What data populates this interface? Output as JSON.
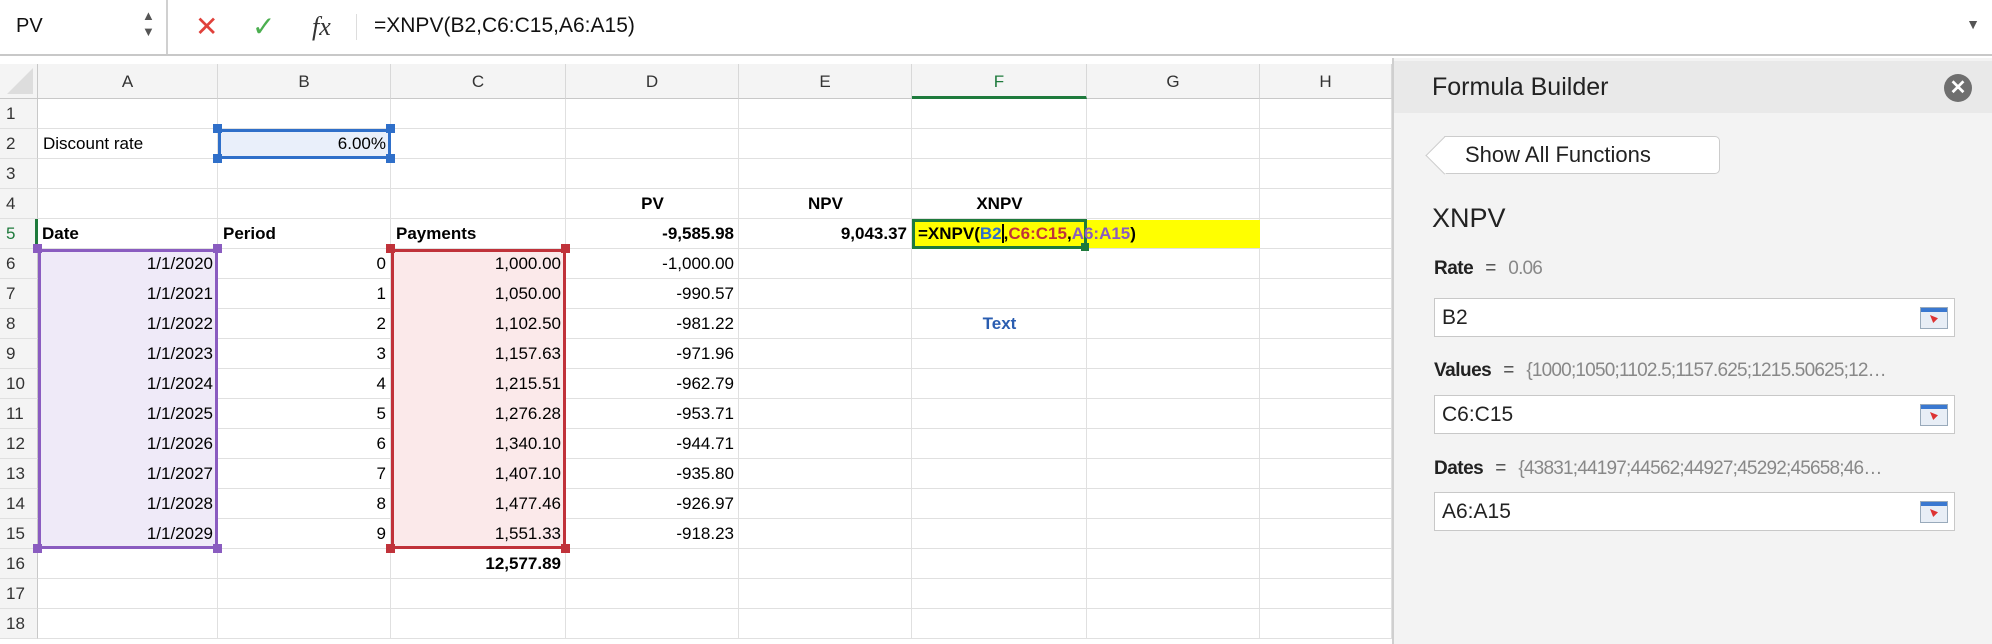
{
  "formula_bar": {
    "name_box": "PV",
    "formula": "=XNPV(B2,C6:C15,A6:A15)",
    "cancel_icon": "x-icon",
    "enter_icon": "check-icon",
    "fx_label": "fx"
  },
  "columns": [
    "A",
    "B",
    "C",
    "D",
    "E",
    "F",
    "G",
    "H"
  ],
  "selected_column": "F",
  "selected_row": 5,
  "rows": [
    "1",
    "2",
    "3",
    "4",
    "5",
    "6",
    "7",
    "8",
    "9",
    "10",
    "11",
    "12",
    "13",
    "14",
    "15",
    "16",
    "17",
    "18"
  ],
  "cells": {
    "A2": "Discount rate",
    "B2": "6.00%",
    "D4": "PV",
    "E4": "NPV",
    "F4": "XNPV",
    "A5": "Date",
    "B5": "Period",
    "C5": "Payments",
    "D5": "-9,585.98",
    "E5": "9,043.37",
    "F8": "Text",
    "C16": "12,577.89"
  },
  "table": [
    {
      "date": "1/1/2020",
      "period": "0",
      "payment": "1,000.00",
      "pv": "-1,000.00"
    },
    {
      "date": "1/1/2021",
      "period": "1",
      "payment": "1,050.00",
      "pv": "-990.57"
    },
    {
      "date": "1/1/2022",
      "period": "2",
      "payment": "1,102.50",
      "pv": "-981.22"
    },
    {
      "date": "1/1/2023",
      "period": "3",
      "payment": "1,157.63",
      "pv": "-971.96"
    },
    {
      "date": "1/1/2024",
      "period": "4",
      "payment": "1,215.51",
      "pv": "-962.79"
    },
    {
      "date": "1/1/2025",
      "period": "5",
      "payment": "1,276.28",
      "pv": "-953.71"
    },
    {
      "date": "1/1/2026",
      "period": "6",
      "payment": "1,340.10",
      "pv": "-944.71"
    },
    {
      "date": "1/1/2027",
      "period": "7",
      "payment": "1,407.10",
      "pv": "-935.80"
    },
    {
      "date": "1/1/2028",
      "period": "8",
      "payment": "1,477.46",
      "pv": "-926.97"
    },
    {
      "date": "1/1/2029",
      "period": "9",
      "payment": "1,551.33",
      "pv": "-918.23"
    }
  ],
  "edit_cell": {
    "prefix": "=XNPV(",
    "arg1": "B2",
    "sep1": ",",
    "arg2": "C6:C15",
    "sep2": ",",
    "arg3": "A6:A15",
    "suffix": ")"
  },
  "colors": {
    "rate_ref": "#2f6fc9",
    "values_ref": "#c0323a",
    "dates_ref": "#8a5cc0",
    "active": "#1e7a3c",
    "edit_fill": "#ffff00"
  },
  "panel": {
    "title": "Formula Builder",
    "close_icon": "close-circle-icon",
    "show_all": "Show All Functions",
    "function_name": "XNPV",
    "args": [
      {
        "label": "Rate",
        "eq": "=",
        "value": "0.06",
        "input": "B2"
      },
      {
        "label": "Values",
        "eq": "=",
        "value": "{1000;1050;1102.5;1157.625;1215.50625;12…",
        "input": "C6:C15"
      },
      {
        "label": "Dates",
        "eq": "=",
        "value": "{43831;44197;44562;44927;45292;45658;46…",
        "input": "A6:A15"
      }
    ]
  }
}
